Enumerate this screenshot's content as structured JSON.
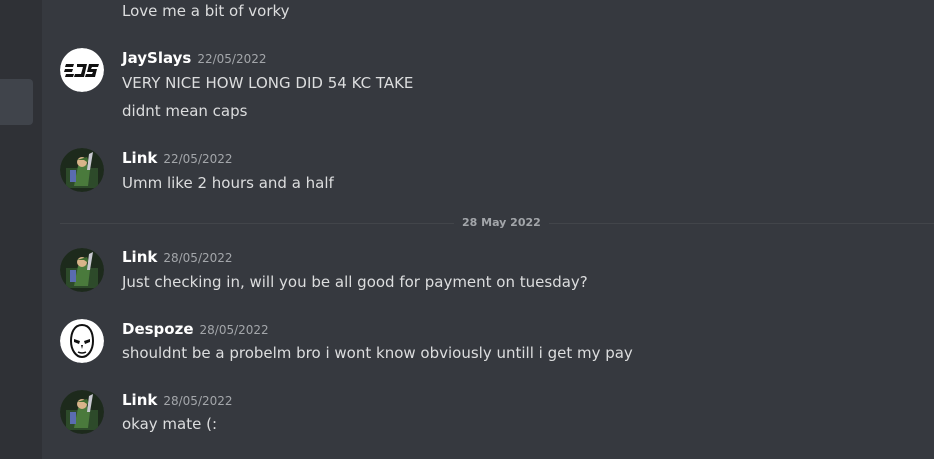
{
  "messages": [
    {
      "continuation_lines": [
        "Love me a bit of vorky"
      ]
    },
    {
      "author": "JaySlays",
      "timestamp": "22/05/2022",
      "avatar_icon": "js-logo-avatar",
      "lines": [
        "VERY NICE HOW LONG DID 54 KC TAKE",
        "didnt mean caps"
      ]
    },
    {
      "author": "Link",
      "timestamp": "22/05/2022",
      "avatar_icon": "link-avatar",
      "lines": [
        "Umm like 2 hours and a half"
      ]
    },
    {
      "author": "Link",
      "timestamp": "28/05/2022",
      "avatar_icon": "link-avatar",
      "lines": [
        "Just checking in, will you be all good for payment on tuesday?"
      ]
    },
    {
      "author": "Despoze",
      "timestamp": "28/05/2022",
      "avatar_icon": "mask-avatar",
      "lines": [
        "shouldnt be a probelm bro i wont know obviously untill i get my pay"
      ]
    },
    {
      "author": "Link",
      "timestamp": "28/05/2022",
      "avatar_icon": "link-avatar",
      "lines": [
        "okay mate (:"
      ]
    }
  ],
  "date_divider": "28 May 2022",
  "colors": {
    "background": "#36393f",
    "rail": "#2f3136",
    "text": "#dcddde",
    "author": "#ffffff",
    "timestamp": "#a3a6aa"
  }
}
